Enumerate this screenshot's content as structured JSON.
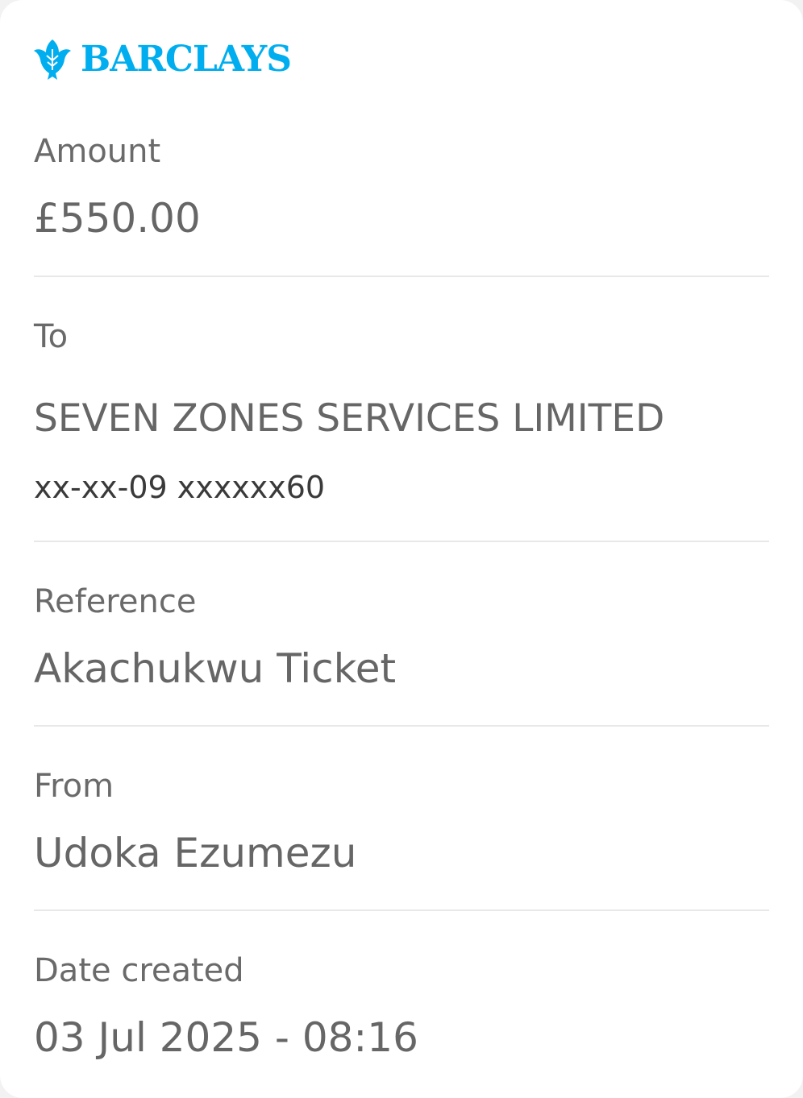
{
  "brand": {
    "name": "BARCLAYS",
    "icon": "eagle-icon",
    "color": "#00aeef"
  },
  "amount": {
    "label": "Amount",
    "value": "£550.00"
  },
  "to": {
    "label": "To",
    "name": "SEVEN ZONES SERVICES LIMITED",
    "account": "xx-xx-09 xxxxxx60"
  },
  "reference": {
    "label": "Reference",
    "value": "Akachukwu Ticket"
  },
  "from": {
    "label": "From",
    "value": "Udoka Ezumezu"
  },
  "date_created": {
    "label": "Date created",
    "value": "03 Jul 2025 - 08:16"
  }
}
